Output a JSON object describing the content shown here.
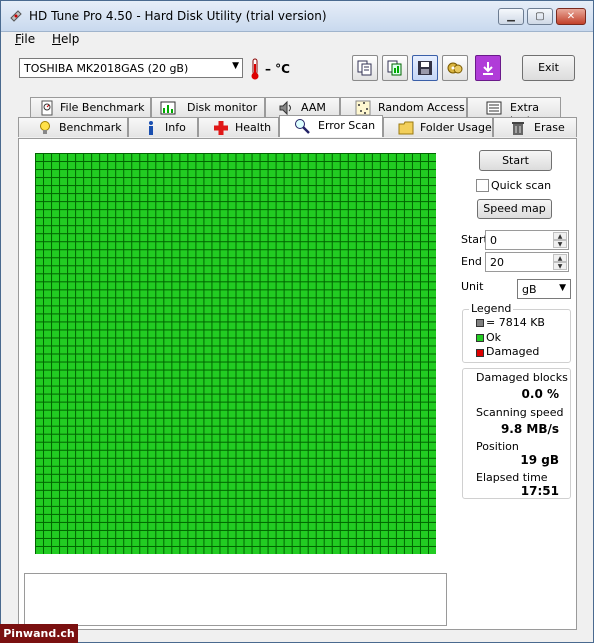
{
  "window": {
    "title": "HD Tune Pro 4.50 - Hard Disk Utility (trial version)"
  },
  "menu": [
    {
      "label": "File",
      "key": "F",
      "rest": "ile"
    },
    {
      "label": "Help",
      "key": "H",
      "rest": "elp"
    }
  ],
  "toolbar": {
    "drive": "TOSHIBA MK2018GAS (20 gB)",
    "temperature": "– °C",
    "exit_label": "Exit",
    "buttons": [
      "copy-text-icon",
      "copy-info-icon",
      "save-icon",
      "options-icon",
      "download-icon"
    ]
  },
  "tabs_top": [
    {
      "label": "File Benchmark",
      "icon": "file-benchmark-icon"
    },
    {
      "label": "Disk monitor",
      "icon": "disk-monitor-icon"
    },
    {
      "label": "AAM",
      "icon": "speaker-icon"
    },
    {
      "label": "Random Access",
      "icon": "random-access-icon"
    },
    {
      "label": "Extra tests",
      "icon": "extra-tests-icon"
    }
  ],
  "tabs_bottom": [
    {
      "label": "Benchmark",
      "icon": "lightbulb-icon"
    },
    {
      "label": "Info",
      "icon": "info-icon"
    },
    {
      "label": "Health",
      "icon": "health-cross-icon"
    },
    {
      "label": "Error Scan",
      "icon": "magnifier-icon",
      "active": true
    },
    {
      "label": "Folder Usage",
      "icon": "folder-icon"
    },
    {
      "label": "Erase",
      "icon": "trash-icon"
    }
  ],
  "scan": {
    "grid_cols": 50,
    "grid_rows": 50,
    "block_color": "#22cc22",
    "border_color": "#006400"
  },
  "controls": {
    "start_button": "Start",
    "quick_scan_label": "Quick scan",
    "quick_scan_checked": false,
    "speed_map_button": "Speed map",
    "start_label": "Start",
    "start_value": "0",
    "end_label": "End",
    "end_value": "20",
    "unit_label": "Unit",
    "unit_value": "gB"
  },
  "legend": {
    "title": "Legend",
    "items": [
      {
        "label": "= 7814 KB",
        "color": "#808080"
      },
      {
        "label": "Ok",
        "color": "#22cc22"
      },
      {
        "label": "Damaged",
        "color": "#dd0000"
      }
    ]
  },
  "stats": {
    "damaged_label": "Damaged blocks",
    "damaged_value": "0.0 %",
    "speed_label": "Scanning speed",
    "speed_value": "9.8 MB/s",
    "position_label": "Position",
    "position_value": "19 gB",
    "elapsed_label": "Elapsed time",
    "elapsed_value": "17:51"
  },
  "watermark": "Pinwand.ch"
}
